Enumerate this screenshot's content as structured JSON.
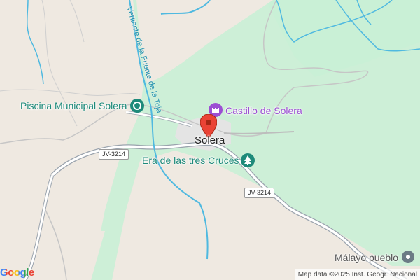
{
  "map": {
    "place": "Solera",
    "river_label": "Vertiente de la Fuente de la Teja",
    "pois": [
      {
        "name": "Piscina Municipal Solera",
        "icon": "pool-icon",
        "color": "#1e8a7a"
      },
      {
        "name": "Castillo de Solera",
        "icon": "castle-icon",
        "color": "#9c4fd3"
      },
      {
        "name": "Era de las tres Cruces",
        "icon": "park-icon",
        "color": "#1e8a7a"
      },
      {
        "name": "Málayo pueblo",
        "icon": "place-icon",
        "color": "#555555"
      }
    ],
    "roads": [
      "JV-3214",
      "JV-3214"
    ],
    "attribution": "Map data ©2025 Inst. Geogr. Nacional",
    "logo": "Google"
  }
}
